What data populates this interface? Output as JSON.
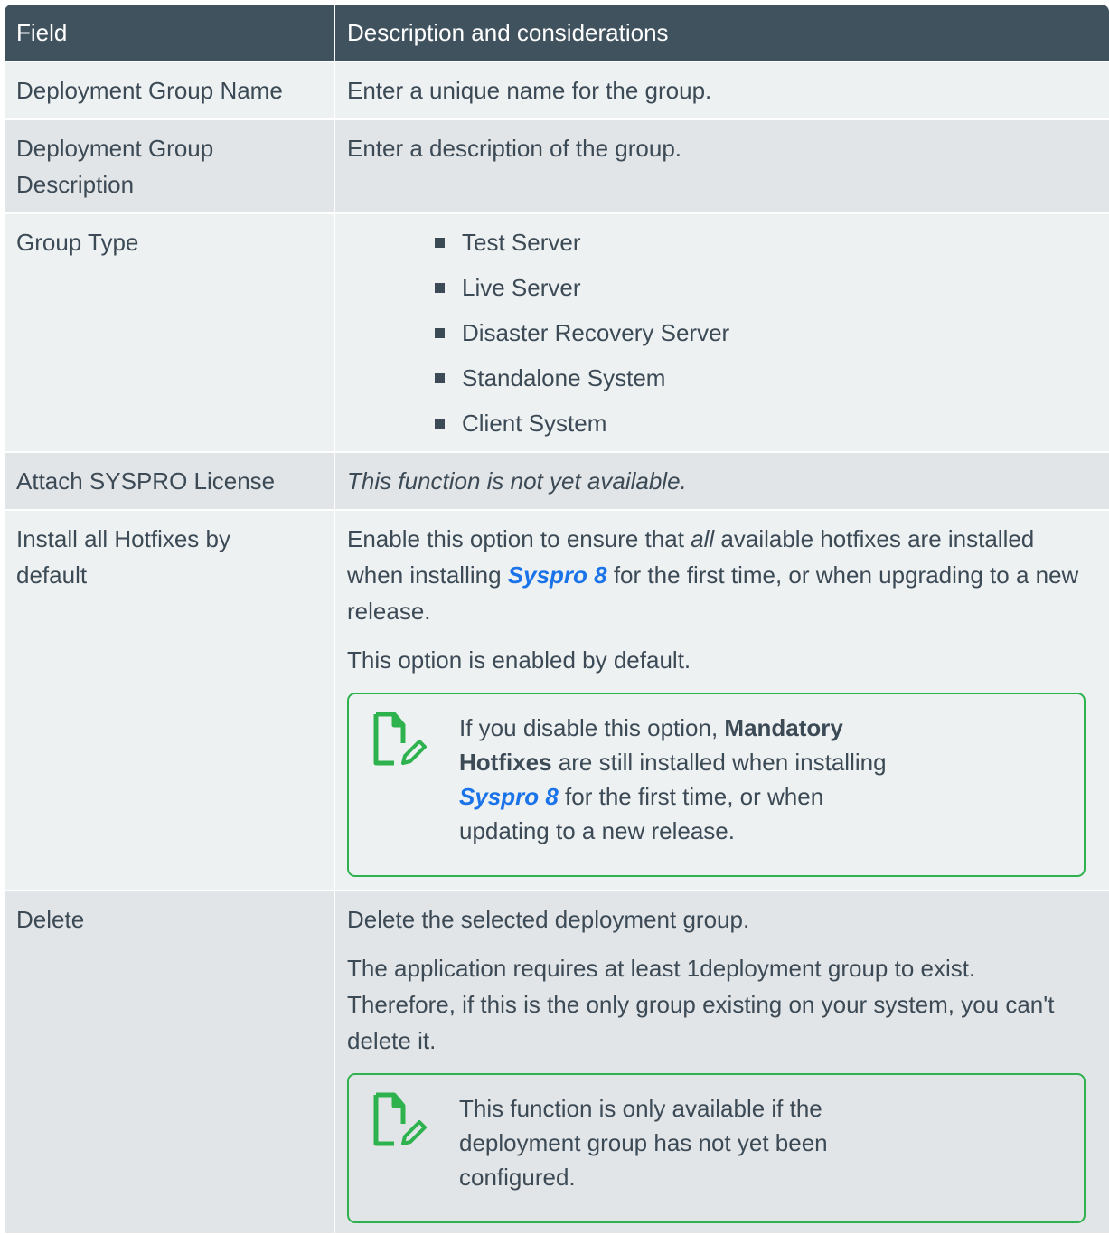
{
  "header": {
    "field": "Field",
    "description": "Description and considerations"
  },
  "rows": [
    {
      "field": "Deployment Group Name",
      "desc": "Enter a unique name for the group."
    },
    {
      "field_line1": "Deployment Group",
      "field_line2": "Description",
      "desc": "Enter a description of the group."
    },
    {
      "field": "Group Type",
      "items": [
        "Test Server",
        "Live Server",
        "Disaster Recovery Server",
        "Standalone System",
        "Client System"
      ]
    },
    {
      "field": "Attach SYSPRO License",
      "desc": "This function is not yet available."
    },
    {
      "field_line1": "Install all Hotfixes by",
      "field_line2": "default",
      "p1_a": "Enable this option to ensure that ",
      "p1_all": "all",
      "p1_b": " available hotfixes are installed when installing ",
      "p1_link": "Syspro 8",
      "p1_c": " for the first time, or when upgrading to a new release.",
      "p2": "This option is enabled by default.",
      "note_a": "If you disable this option, ",
      "note_bold": "Mandatory Hotfixes",
      "note_b": " are still installed when installing ",
      "note_link": "Syspro 8",
      "note_c": " for the first time, or when updating to a new release."
    },
    {
      "field": "Delete",
      "p1": "Delete the selected deployment group.",
      "p2": "The application requires at least 1deployment group to exist. Therefore, if this is the only group existing on your system, you can't delete it.",
      "note": "This function is only available if the deployment group has not yet been configured."
    }
  ],
  "icons": {
    "note": "note-edit-icon"
  },
  "colors": {
    "header_bg": "#41525f",
    "note_border": "#2eb24e",
    "link": "#1a73e8"
  }
}
